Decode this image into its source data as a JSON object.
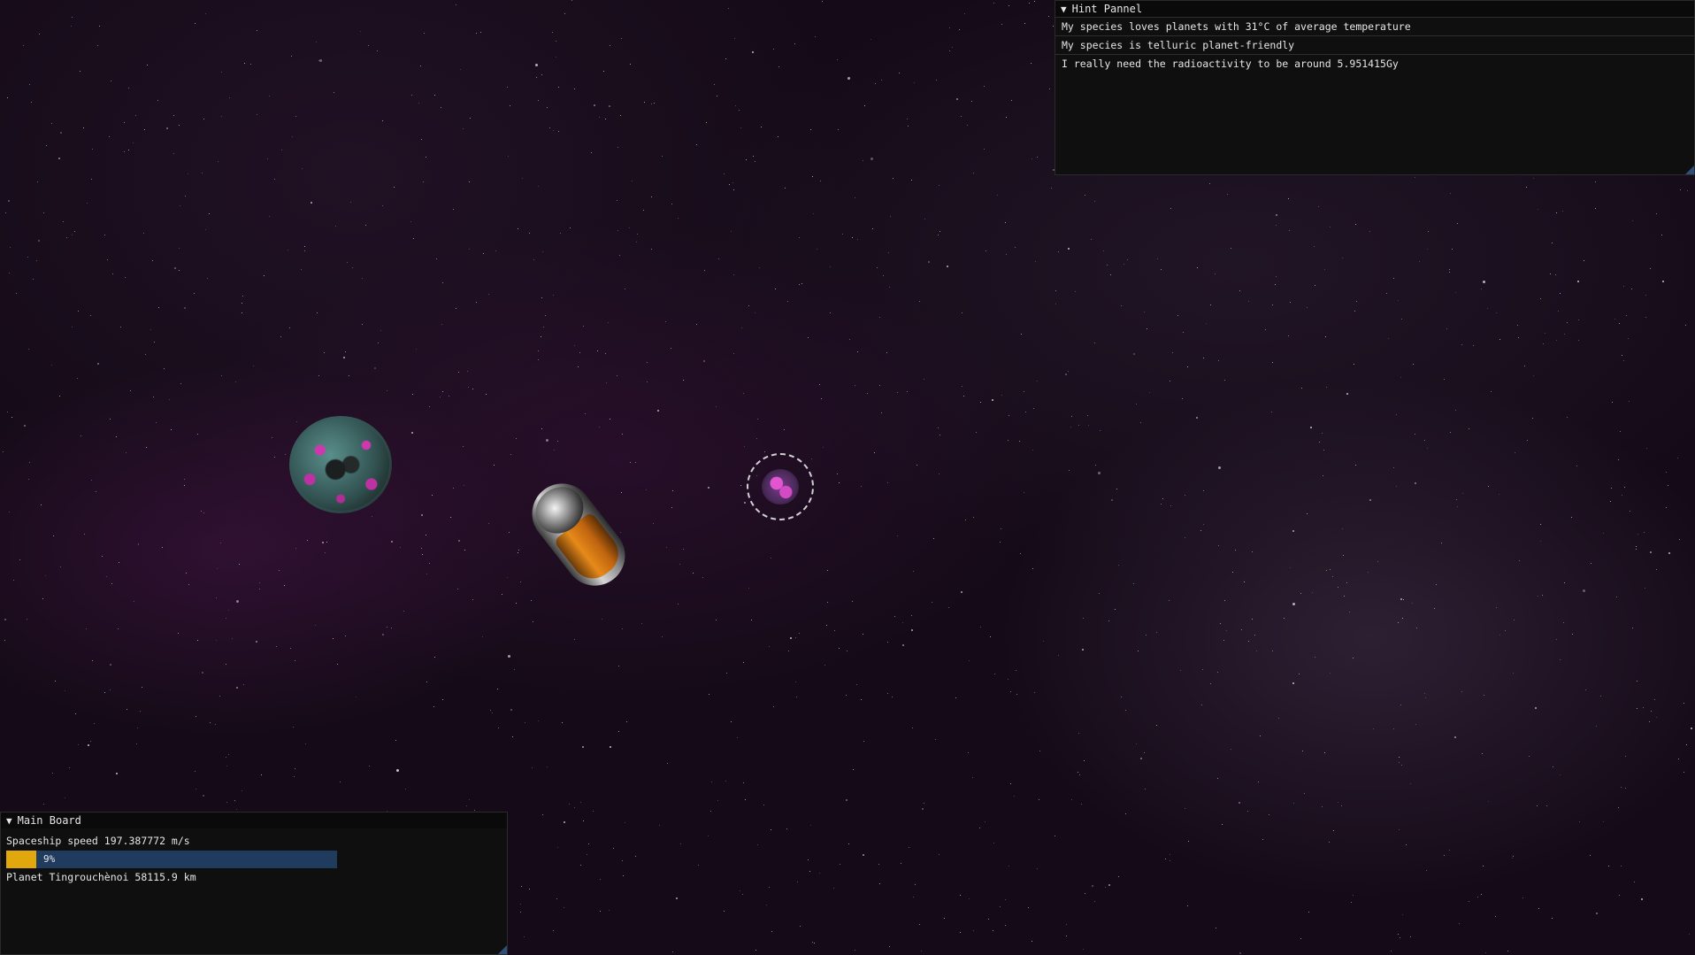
{
  "hint_panel": {
    "title": "Hint Pannel",
    "hints": [
      "My species loves planets with 31°C of average temperature",
      "My species is telluric planet-friendly",
      "I really need the radioactivity to be around 5.951415Gy"
    ]
  },
  "main_board": {
    "title": "Main Board",
    "speed_text": "Spaceship speed 197.387772 m/s",
    "progress": {
      "value": 0.09,
      "label": "9%"
    },
    "planet_text": "Planet Tingrouchènoi 58115.9 km"
  },
  "colors": {
    "progress_fill": "#e0a80c",
    "progress_track": "#1f3b5e",
    "panel_bg": "#0f0f0f"
  },
  "icons": {
    "collapse": "triangle-down-icon"
  }
}
